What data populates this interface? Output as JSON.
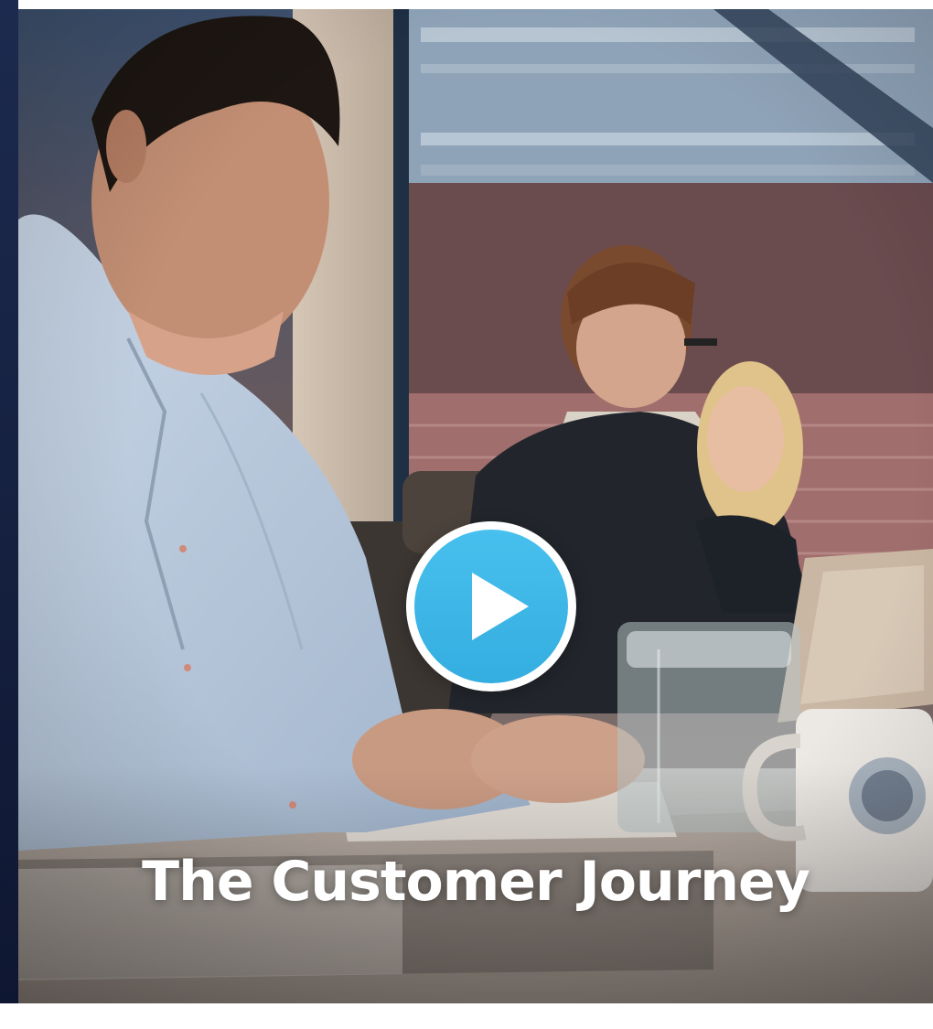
{
  "video": {
    "title": "The Customer Journey",
    "play_label": "Play",
    "thumbnail_description": "",
    "accent_color": "#3db8e8"
  },
  "icons": {
    "play": "play-icon"
  }
}
